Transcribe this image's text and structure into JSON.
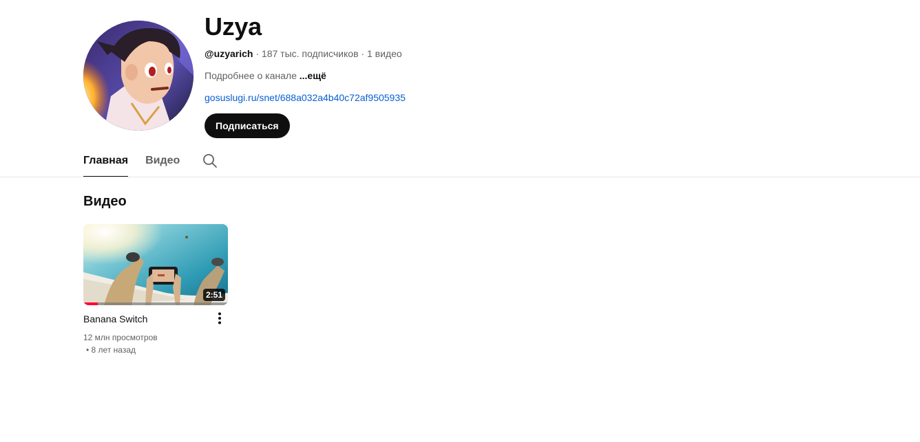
{
  "channel": {
    "name": "Uzya",
    "handle": "@uzyarich",
    "subscribers": "187 тыс. подписчиков",
    "video_count": "1 видео",
    "separator": "·",
    "about_text": "Подробнее о канале",
    "about_more": "...ещё",
    "link": "gosuslugi.ru/snet/688a032a4b40c72af9505935",
    "subscribe_label": "Подписаться"
  },
  "tabs": [
    {
      "label": "Главная",
      "active": true
    },
    {
      "label": "Видео",
      "active": false
    }
  ],
  "search_icon": "search-icon",
  "section": {
    "title": "Видео"
  },
  "videos": [
    {
      "title": "Banana Switch",
      "duration": "2:51",
      "views": "12 млн просмотров",
      "age": "• 8 лет назад",
      "progress": 0.1
    }
  ],
  "colors": {
    "link": "#065fd4",
    "subscribe_bg": "#0f0f0f",
    "progress": "#ff0033"
  }
}
